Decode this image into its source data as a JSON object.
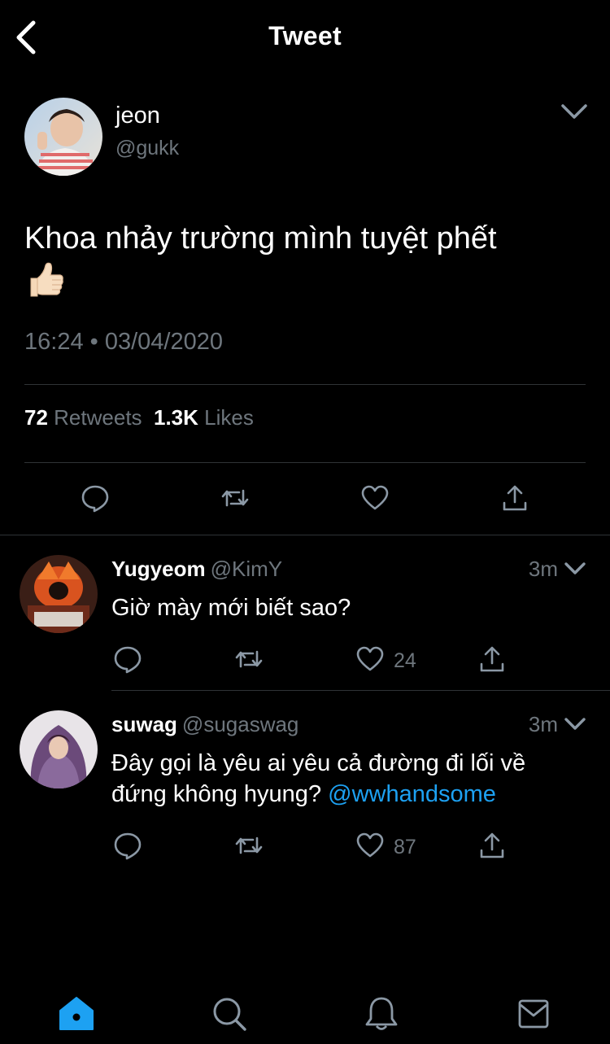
{
  "header": {
    "title": "Tweet"
  },
  "tweet": {
    "author": "jeon",
    "handle": "@gukk",
    "text": "Khoa nhảy trường mình tuyệt phết",
    "emoji": "thumbs-up-light-skin",
    "timestamp": "16:24 • 03/04/2020",
    "retweets_count": "72",
    "retweets_label": "Retweets",
    "likes_count": "1.3K",
    "likes_label": "Likes"
  },
  "replies": [
    {
      "name": "Yugyeom",
      "handle": "@KimY",
      "time": "3m",
      "text": "Giờ mày mới biết sao?",
      "mention": "",
      "likes": "24"
    },
    {
      "name": "suwag",
      "handle": "@sugaswag",
      "time": "3m",
      "text": "Đây gọi là yêu ai yêu cả đường đi lối về đứng không hyung? ",
      "mention": "@wwhandsome",
      "likes": "87"
    }
  ],
  "tabbar": {
    "items": [
      "home-icon",
      "search-icon",
      "notifications-icon",
      "messages-icon"
    ],
    "active": "home-icon"
  },
  "colors": {
    "background": "#000000",
    "text": "#ffffff",
    "secondary": "#6e767d",
    "accent": "#1da1f2",
    "divider": "#2f3336"
  }
}
